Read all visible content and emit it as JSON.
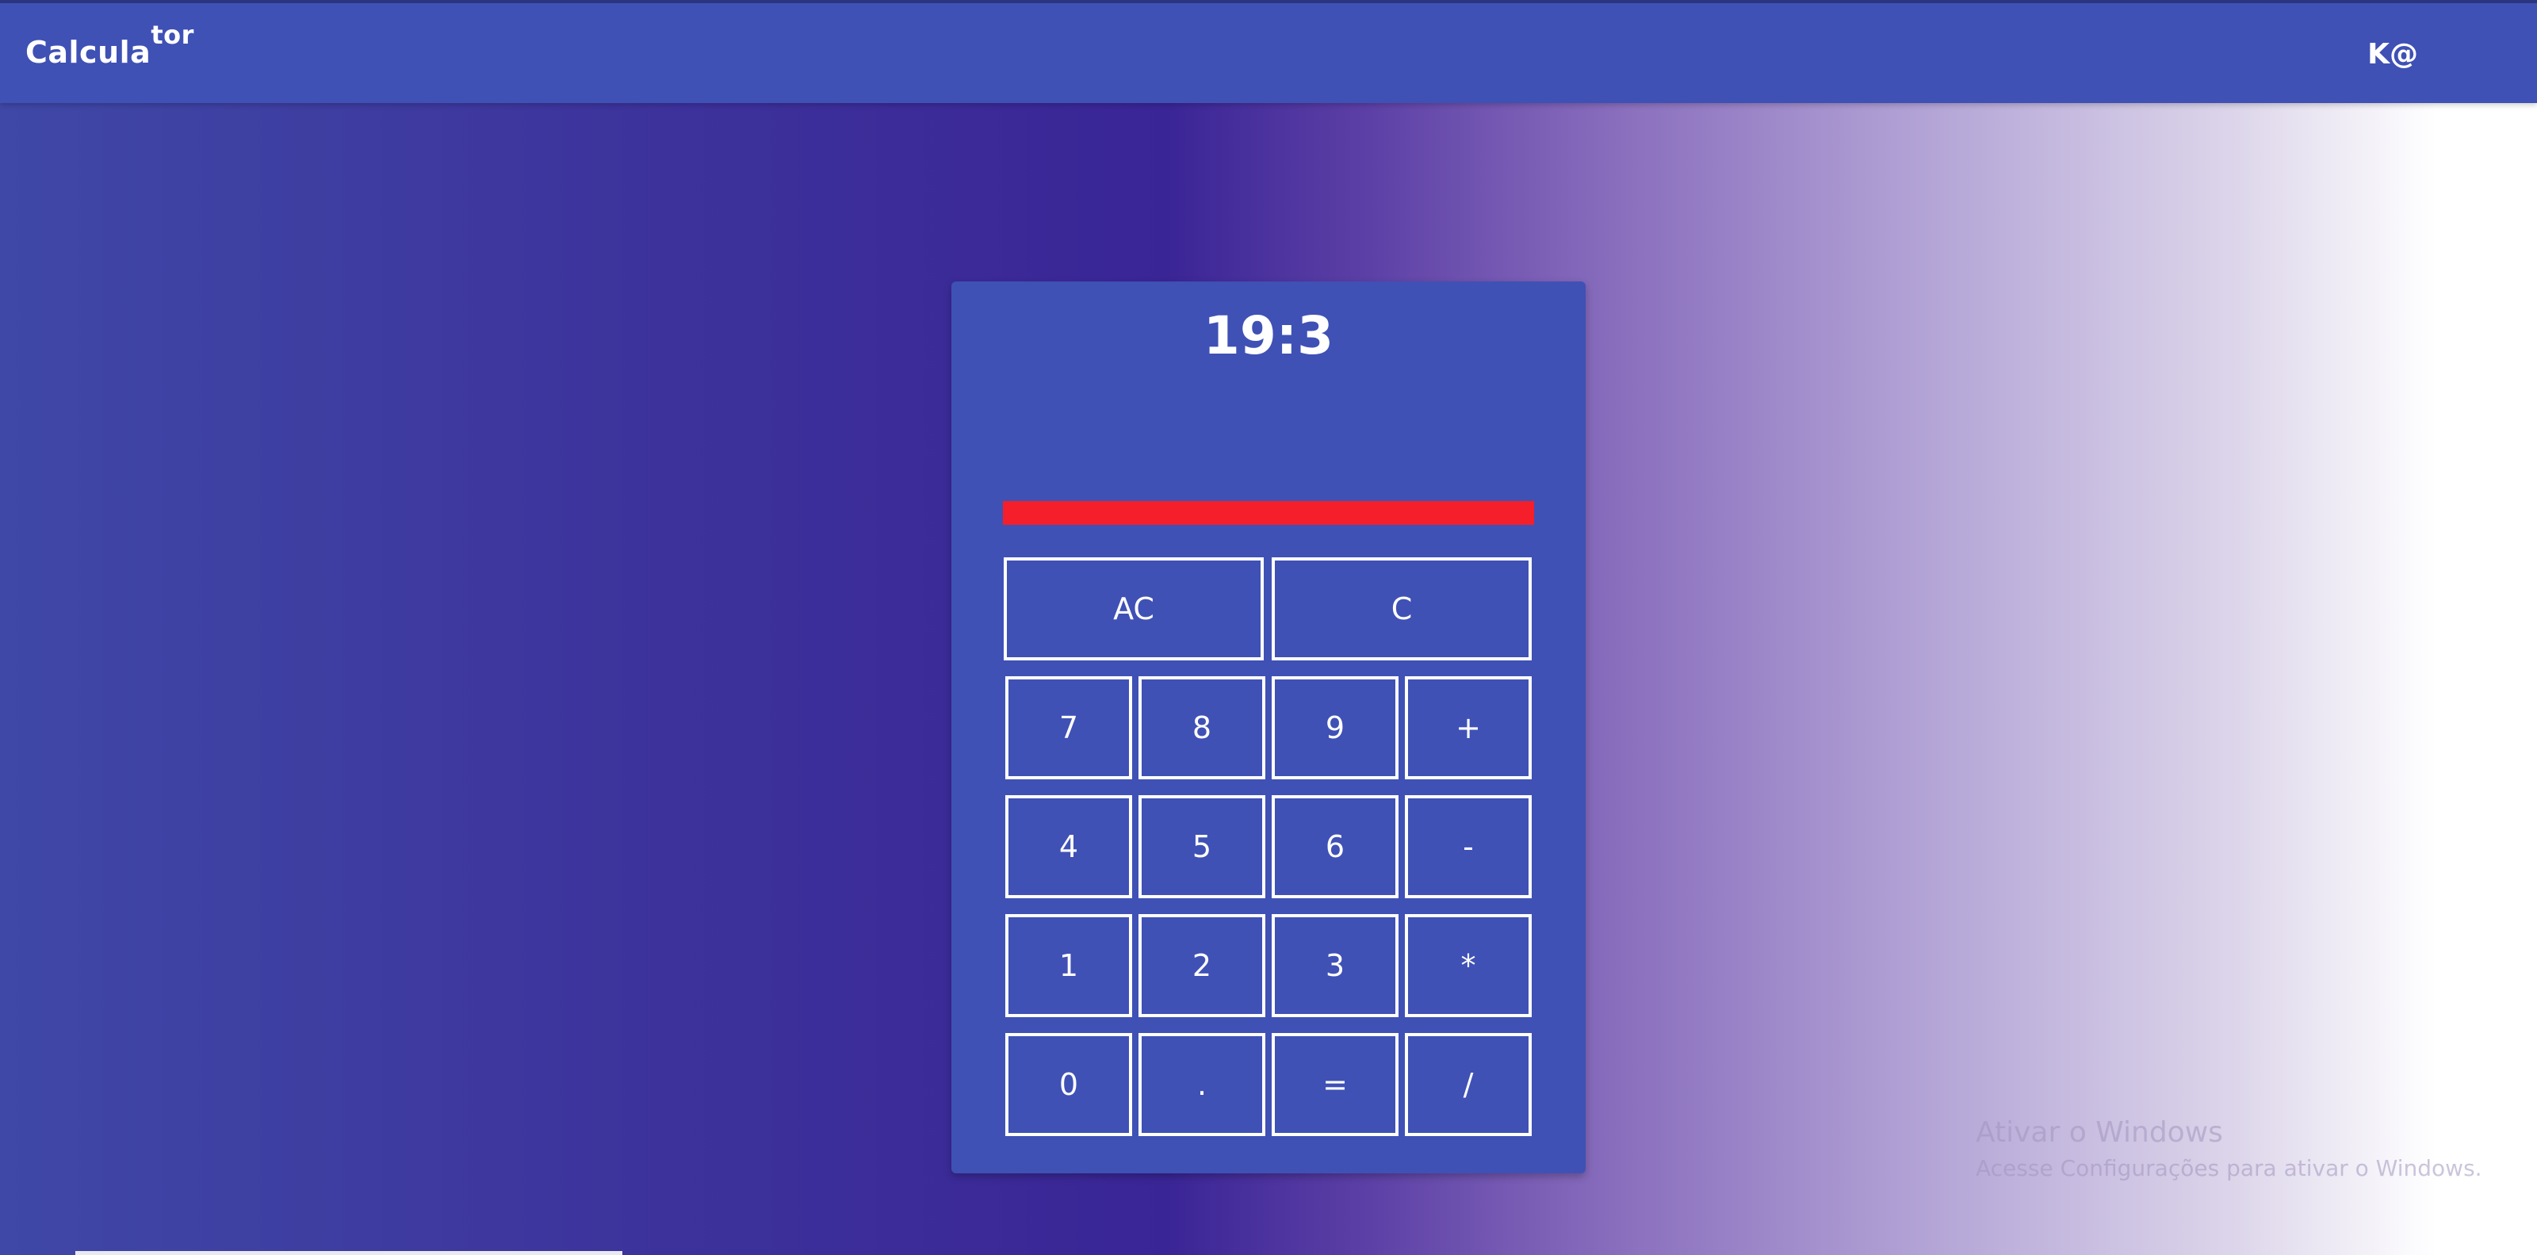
{
  "header": {
    "brand_main": "Calcula",
    "brand_sup": "tor",
    "user": "K@"
  },
  "calculator": {
    "display": "19:3",
    "error_bar_color": "#f41f2a",
    "buttons": {
      "ac": "AC",
      "c": "C",
      "seven": "7",
      "eight": "8",
      "nine": "9",
      "plus": "+",
      "four": "4",
      "five": "5",
      "six": "6",
      "minus": "-",
      "one": "1",
      "two": "2",
      "three": "3",
      "multiply": "*",
      "zero": "0",
      "dot": ".",
      "equals": "=",
      "divide": "/"
    }
  },
  "watermark": {
    "title": "Ativar o Windows",
    "subtitle": "Acesse Configurações para ativar o Windows."
  },
  "colors": {
    "primary": "#3f51b5",
    "error": "#f41f2a"
  }
}
